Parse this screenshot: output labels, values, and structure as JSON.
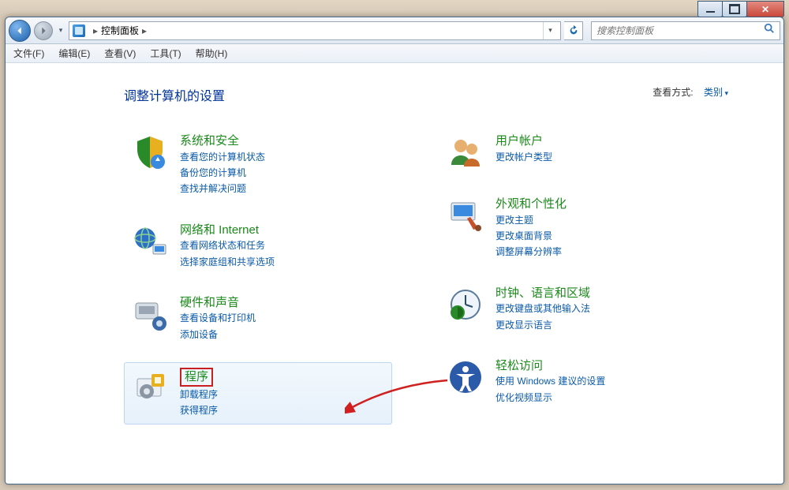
{
  "window": {
    "title": "控制面板"
  },
  "nav": {
    "breadcrumb_root": "控制面板",
    "search_placeholder": "搜索控制面板"
  },
  "menu": {
    "file": "文件(F)",
    "edit": "编辑(E)",
    "view": "查看(V)",
    "tools": "工具(T)",
    "help": "帮助(H)"
  },
  "page": {
    "heading": "调整计算机的设置",
    "viewby_label": "查看方式:",
    "viewby_value": "类别"
  },
  "left_categories": [
    {
      "title": "系统和安全",
      "links": [
        "查看您的计算机状态",
        "备份您的计算机",
        "查找并解决问题"
      ]
    },
    {
      "title": "网络和 Internet",
      "links": [
        "查看网络状态和任务",
        "选择家庭组和共享选项"
      ]
    },
    {
      "title": "硬件和声音",
      "links": [
        "查看设备和打印机",
        "添加设备"
      ]
    },
    {
      "title": "程序",
      "links": [
        "卸载程序",
        "获得程序"
      ]
    }
  ],
  "right_categories": [
    {
      "title": "用户帐户",
      "links": [
        "更改帐户类型"
      ]
    },
    {
      "title": "外观和个性化",
      "links": [
        "更改主题",
        "更改桌面背景",
        "调整屏幕分辨率"
      ]
    },
    {
      "title": "时钟、语言和区域",
      "links": [
        "更改键盘或其他输入法",
        "更改显示语言"
      ]
    },
    {
      "title": "轻松访问",
      "links": [
        "使用 Windows 建议的设置",
        "优化视频显示"
      ]
    }
  ],
  "annotation": {
    "highlight_category_title": "程序"
  }
}
